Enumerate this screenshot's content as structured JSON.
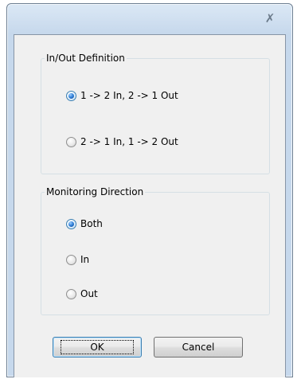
{
  "window": {
    "title": ""
  },
  "groups": {
    "inout": {
      "legend": "In/Out Definition",
      "options": [
        {
          "label": "1 -> 2 In, 2 -> 1 Out",
          "checked": true
        },
        {
          "label": "2 -> 1 In, 1 -> 2 Out",
          "checked": false
        }
      ]
    },
    "monitoring": {
      "legend": "Monitoring Direction",
      "options": [
        {
          "label": "Both",
          "checked": true
        },
        {
          "label": "In",
          "checked": false
        },
        {
          "label": "Out",
          "checked": false
        }
      ]
    }
  },
  "buttons": {
    "ok_label": "OK",
    "cancel_label": "Cancel"
  },
  "icons": {
    "close": "close-icon",
    "radio": "radio-icon"
  },
  "colors": {
    "accent": "#3c7fb1",
    "client_bg": "#f0f0f0",
    "frame": "#c6d8ec"
  }
}
